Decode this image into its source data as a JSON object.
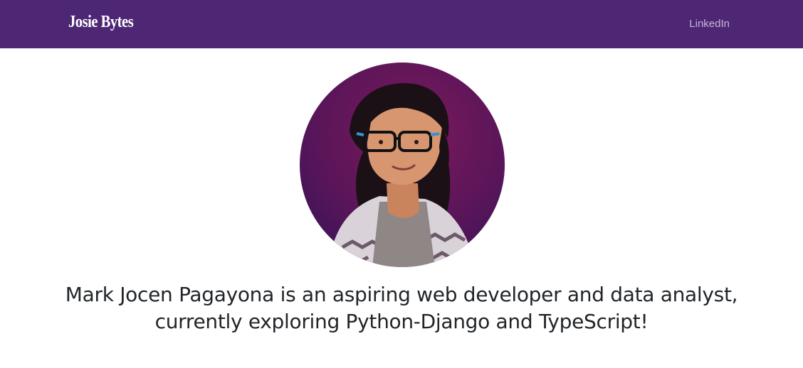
{
  "navbar": {
    "brand": "Josie Bytes",
    "links": [
      {
        "label": "LinkedIn"
      }
    ],
    "background_color": "#4e2774"
  },
  "profile": {
    "avatar_icon": "profile-illustration",
    "bio": "Mark Jocen Pagayona is an aspiring web developer and data analyst, currently exploring Python-Django and TypeScript!"
  }
}
